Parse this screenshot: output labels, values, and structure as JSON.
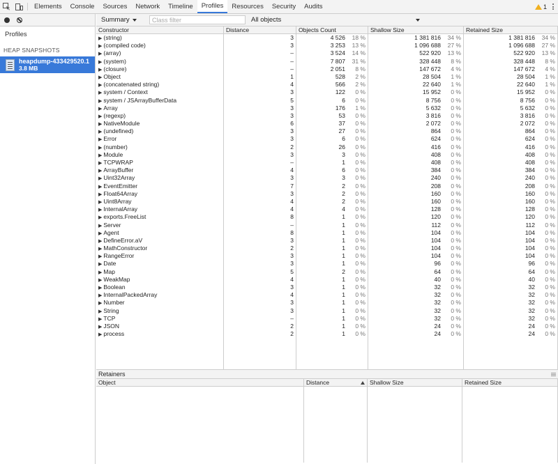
{
  "topbar": {
    "tabs": [
      "Elements",
      "Console",
      "Sources",
      "Network",
      "Timeline",
      "Profiles",
      "Resources",
      "Security",
      "Audits"
    ],
    "active_tab": "Profiles",
    "warning_count": "1"
  },
  "sidebar": {
    "title": "Profiles",
    "section": "HEAP SNAPSHOTS",
    "snapshot": {
      "name": "heapdump-433429520.1",
      "size": "3.8 MB"
    }
  },
  "toolbar": {
    "view": "Summary",
    "filter_placeholder": "Class filter",
    "objects": "All objects"
  },
  "grid": {
    "headers": [
      "Constructor",
      "Distance",
      "Objects Count",
      "Shallow Size",
      "Retained Size"
    ],
    "rows": [
      {
        "name": "(string)",
        "distance": "3",
        "count": "4 526",
        "count_pct": "18 %",
        "shallow": "1 381 816",
        "shallow_pct": "34 %",
        "retained": "1 381 816",
        "retained_pct": "34 %"
      },
      {
        "name": "(compiled code)",
        "distance": "3",
        "count": "3 253",
        "count_pct": "13 %",
        "shallow": "1 096 688",
        "shallow_pct": "27 %",
        "retained": "1 096 688",
        "retained_pct": "27 %"
      },
      {
        "name": "(array)",
        "distance": "–",
        "count": "3 524",
        "count_pct": "14 %",
        "shallow": "522 920",
        "shallow_pct": "13 %",
        "retained": "522 920",
        "retained_pct": "13 %"
      },
      {
        "name": "(system)",
        "distance": "–",
        "count": "7 807",
        "count_pct": "31 %",
        "shallow": "328 448",
        "shallow_pct": "8 %",
        "retained": "328 448",
        "retained_pct": "8 %"
      },
      {
        "name": "(closure)",
        "distance": "–",
        "count": "2 051",
        "count_pct": "8 %",
        "shallow": "147 672",
        "shallow_pct": "4 %",
        "retained": "147 672",
        "retained_pct": "4 %"
      },
      {
        "name": "Object",
        "distance": "1",
        "count": "528",
        "count_pct": "2 %",
        "shallow": "28 504",
        "shallow_pct": "1 %",
        "retained": "28 504",
        "retained_pct": "1 %"
      },
      {
        "name": "(concatenated string)",
        "distance": "4",
        "count": "566",
        "count_pct": "2 %",
        "shallow": "22 640",
        "shallow_pct": "1 %",
        "retained": "22 640",
        "retained_pct": "1 %"
      },
      {
        "name": "system / Context",
        "distance": "3",
        "count": "122",
        "count_pct": "0 %",
        "shallow": "15 952",
        "shallow_pct": "0 %",
        "retained": "15 952",
        "retained_pct": "0 %"
      },
      {
        "name": "system / JSArrayBufferData",
        "distance": "5",
        "count": "6",
        "count_pct": "0 %",
        "shallow": "8 756",
        "shallow_pct": "0 %",
        "retained": "8 756",
        "retained_pct": "0 %"
      },
      {
        "name": "Array",
        "distance": "3",
        "count": "176",
        "count_pct": "1 %",
        "shallow": "5 632",
        "shallow_pct": "0 %",
        "retained": "5 632",
        "retained_pct": "0 %"
      },
      {
        "name": "(regexp)",
        "distance": "3",
        "count": "53",
        "count_pct": "0 %",
        "shallow": "3 816",
        "shallow_pct": "0 %",
        "retained": "3 816",
        "retained_pct": "0 %"
      },
      {
        "name": "NativeModule",
        "distance": "6",
        "count": "37",
        "count_pct": "0 %",
        "shallow": "2 072",
        "shallow_pct": "0 %",
        "retained": "2 072",
        "retained_pct": "0 %"
      },
      {
        "name": "(undefined)",
        "distance": "3",
        "count": "27",
        "count_pct": "0 %",
        "shallow": "864",
        "shallow_pct": "0 %",
        "retained": "864",
        "retained_pct": "0 %"
      },
      {
        "name": "Error",
        "distance": "3",
        "count": "6",
        "count_pct": "0 %",
        "shallow": "624",
        "shallow_pct": "0 %",
        "retained": "624",
        "retained_pct": "0 %"
      },
      {
        "name": "(number)",
        "distance": "2",
        "count": "26",
        "count_pct": "0 %",
        "shallow": "416",
        "shallow_pct": "0 %",
        "retained": "416",
        "retained_pct": "0 %"
      },
      {
        "name": "Module",
        "distance": "3",
        "count": "3",
        "count_pct": "0 %",
        "shallow": "408",
        "shallow_pct": "0 %",
        "retained": "408",
        "retained_pct": "0 %"
      },
      {
        "name": "TCPWRAP",
        "distance": "–",
        "count": "1",
        "count_pct": "0 %",
        "shallow": "408",
        "shallow_pct": "0 %",
        "retained": "408",
        "retained_pct": "0 %"
      },
      {
        "name": "ArrayBuffer",
        "distance": "4",
        "count": "6",
        "count_pct": "0 %",
        "shallow": "384",
        "shallow_pct": "0 %",
        "retained": "384",
        "retained_pct": "0 %"
      },
      {
        "name": "Uint32Array",
        "distance": "3",
        "count": "3",
        "count_pct": "0 %",
        "shallow": "240",
        "shallow_pct": "0 %",
        "retained": "240",
        "retained_pct": "0 %"
      },
      {
        "name": "EventEmitter",
        "distance": "7",
        "count": "2",
        "count_pct": "0 %",
        "shallow": "208",
        "shallow_pct": "0 %",
        "retained": "208",
        "retained_pct": "0 %"
      },
      {
        "name": "Float64Array",
        "distance": "3",
        "count": "2",
        "count_pct": "0 %",
        "shallow": "160",
        "shallow_pct": "0 %",
        "retained": "160",
        "retained_pct": "0 %"
      },
      {
        "name": "Uint8Array",
        "distance": "4",
        "count": "2",
        "count_pct": "0 %",
        "shallow": "160",
        "shallow_pct": "0 %",
        "retained": "160",
        "retained_pct": "0 %"
      },
      {
        "name": "InternalArray",
        "distance": "4",
        "count": "4",
        "count_pct": "0 %",
        "shallow": "128",
        "shallow_pct": "0 %",
        "retained": "128",
        "retained_pct": "0 %"
      },
      {
        "name": "exports.FreeList",
        "distance": "8",
        "count": "1",
        "count_pct": "0 %",
        "shallow": "120",
        "shallow_pct": "0 %",
        "retained": "120",
        "retained_pct": "0 %"
      },
      {
        "name": "Server",
        "distance": "–",
        "count": "1",
        "count_pct": "0 %",
        "shallow": "112",
        "shallow_pct": "0 %",
        "retained": "112",
        "retained_pct": "0 %"
      },
      {
        "name": "Agent",
        "distance": "8",
        "count": "1",
        "count_pct": "0 %",
        "shallow": "104",
        "shallow_pct": "0 %",
        "retained": "104",
        "retained_pct": "0 %"
      },
      {
        "name": "DefineError.aV",
        "distance": "3",
        "count": "1",
        "count_pct": "0 %",
        "shallow": "104",
        "shallow_pct": "0 %",
        "retained": "104",
        "retained_pct": "0 %"
      },
      {
        "name": "MathConstructor",
        "distance": "2",
        "count": "1",
        "count_pct": "0 %",
        "shallow": "104",
        "shallow_pct": "0 %",
        "retained": "104",
        "retained_pct": "0 %"
      },
      {
        "name": "RangeError",
        "distance": "3",
        "count": "1",
        "count_pct": "0 %",
        "shallow": "104",
        "shallow_pct": "0 %",
        "retained": "104",
        "retained_pct": "0 %"
      },
      {
        "name": "Date",
        "distance": "3",
        "count": "1",
        "count_pct": "0 %",
        "shallow": "96",
        "shallow_pct": "0 %",
        "retained": "96",
        "retained_pct": "0 %"
      },
      {
        "name": "Map",
        "distance": "5",
        "count": "2",
        "count_pct": "0 %",
        "shallow": "64",
        "shallow_pct": "0 %",
        "retained": "64",
        "retained_pct": "0 %"
      },
      {
        "name": "WeakMap",
        "distance": "4",
        "count": "1",
        "count_pct": "0 %",
        "shallow": "40",
        "shallow_pct": "0 %",
        "retained": "40",
        "retained_pct": "0 %"
      },
      {
        "name": "Boolean",
        "distance": "3",
        "count": "1",
        "count_pct": "0 %",
        "shallow": "32",
        "shallow_pct": "0 %",
        "retained": "32",
        "retained_pct": "0 %"
      },
      {
        "name": "InternalPackedArray",
        "distance": "4",
        "count": "1",
        "count_pct": "0 %",
        "shallow": "32",
        "shallow_pct": "0 %",
        "retained": "32",
        "retained_pct": "0 %"
      },
      {
        "name": "Number",
        "distance": "3",
        "count": "1",
        "count_pct": "0 %",
        "shallow": "32",
        "shallow_pct": "0 %",
        "retained": "32",
        "retained_pct": "0 %"
      },
      {
        "name": "String",
        "distance": "3",
        "count": "1",
        "count_pct": "0 %",
        "shallow": "32",
        "shallow_pct": "0 %",
        "retained": "32",
        "retained_pct": "0 %"
      },
      {
        "name": "TCP",
        "distance": "–",
        "count": "1",
        "count_pct": "0 %",
        "shallow": "32",
        "shallow_pct": "0 %",
        "retained": "32",
        "retained_pct": "0 %"
      },
      {
        "name": "JSON",
        "distance": "2",
        "count": "1",
        "count_pct": "0 %",
        "shallow": "24",
        "shallow_pct": "0 %",
        "retained": "24",
        "retained_pct": "0 %"
      },
      {
        "name": "process",
        "distance": "2",
        "count": "1",
        "count_pct": "0 %",
        "shallow": "24",
        "shallow_pct": "0 %",
        "retained": "24",
        "retained_pct": "0 %"
      }
    ]
  },
  "retainers": {
    "title": "Retainers",
    "headers": [
      "Object",
      "Distance",
      "Shallow Size",
      "Retained Size"
    ]
  },
  "colors": {
    "accent": "#3879d9",
    "warning": "#f0b020"
  }
}
